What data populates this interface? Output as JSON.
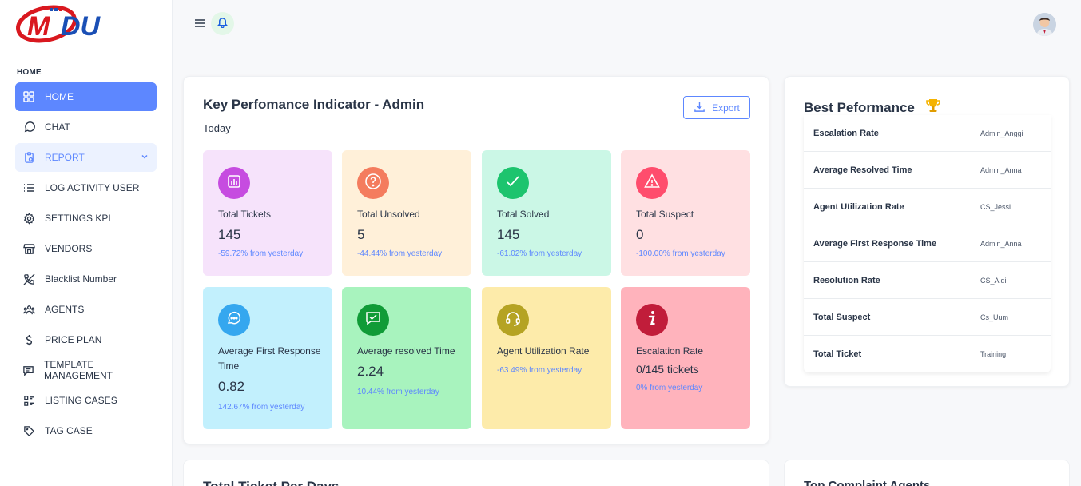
{
  "sidebar": {
    "logo_text": "MDU",
    "section_title": "HOME",
    "items": [
      {
        "label": "HOME",
        "icon": "grid-icon"
      },
      {
        "label": "CHAT",
        "icon": "chat-bubble-icon"
      },
      {
        "label": "REPORT",
        "icon": "clipboard-icon"
      },
      {
        "label": "LOG ACTIVITY USER",
        "icon": "list-icon"
      },
      {
        "label": "SETTINGS KPI",
        "icon": "gear-icon"
      },
      {
        "label": "VENDORS",
        "icon": "building-icon"
      },
      {
        "label": "Blacklist Number",
        "icon": "phone-off-icon"
      },
      {
        "label": "AGENTS",
        "icon": "users-icon"
      },
      {
        "label": "PRICE PLAN",
        "icon": "dollar-icon"
      },
      {
        "label": "TEMPLATE MANAGEMENT",
        "icon": "message-square-icon"
      },
      {
        "label": "LISTING CASES",
        "icon": "list-details-icon"
      },
      {
        "label": "TAG CASE",
        "icon": "tag-icon"
      }
    ]
  },
  "kpi": {
    "title": "Key Perfomance Indicator - Admin",
    "subtitle": "Today",
    "export_label": "Export",
    "tiles": [
      {
        "label": "Total Tickets",
        "value": "145",
        "change": "-59.72% from yesterday",
        "bg": "#f6e3fb",
        "icon_bg": "#c64ce0",
        "icon": "bar-chart-icon"
      },
      {
        "label": "Total Unsolved",
        "value": "5",
        "change": "-44.44% from yesterday",
        "bg": "#fff0d9",
        "icon_bg": "#f47c5e",
        "icon": "question-circle-icon"
      },
      {
        "label": "Total Solved",
        "value": "145",
        "change": "-61.02% from yesterday",
        "bg": "#cbf7e6",
        "icon_bg": "#1dc46e",
        "icon": "check-icon"
      },
      {
        "label": "Total Suspect",
        "value": "0",
        "change": "-100.00% from yesterday",
        "bg": "#ffe0e2",
        "icon_bg": "#ff4d6d",
        "icon": "warning-icon"
      },
      {
        "label": "Average First Response Time",
        "value": "0.82",
        "change": "142.67% from yesterday",
        "bg": "#c2f0fd",
        "icon_bg": "#35a7ef",
        "icon": "chat-dots-icon"
      },
      {
        "label": "Average resolved Time",
        "value": "2.24",
        "change": "10.44% from yesterday",
        "bg": "#a8f3be",
        "icon_bg": "#109b37",
        "icon": "message-check-icon"
      },
      {
        "label": "Agent Utilization Rate",
        "value": "",
        "change": "-63.49% from yesterday",
        "bg": "#fdebaa",
        "icon_bg": "#b5a323",
        "icon": "headset-icon"
      },
      {
        "label": "Escalation Rate",
        "value": "0/145 tickets",
        "change": "0% from yesterday",
        "bg": "#ffb3bc",
        "icon_bg": "#c11d3a",
        "icon": "info-icon"
      }
    ]
  },
  "best": {
    "title": "Best Peformance",
    "icon": "trophy-icon",
    "rows": [
      {
        "metric": "Escalation Rate",
        "winner": "Admin_Anggi"
      },
      {
        "metric": "Average Resolved Time",
        "winner": "Admin_Anna"
      },
      {
        "metric": "Agent Utilization Rate",
        "winner": "CS_Jessi"
      },
      {
        "metric": "Average First Response Time",
        "winner": "Admin_Anna"
      },
      {
        "metric": "Resolution Rate",
        "winner": "CS_Aldi"
      },
      {
        "metric": "Total Suspect",
        "winner": "Cs_Uum"
      },
      {
        "metric": "Total Ticket",
        "winner": "Training"
      }
    ]
  },
  "bottom": {
    "left_title": "Total Ticket Per Days",
    "right_title": "Top Complaint Agents"
  }
}
